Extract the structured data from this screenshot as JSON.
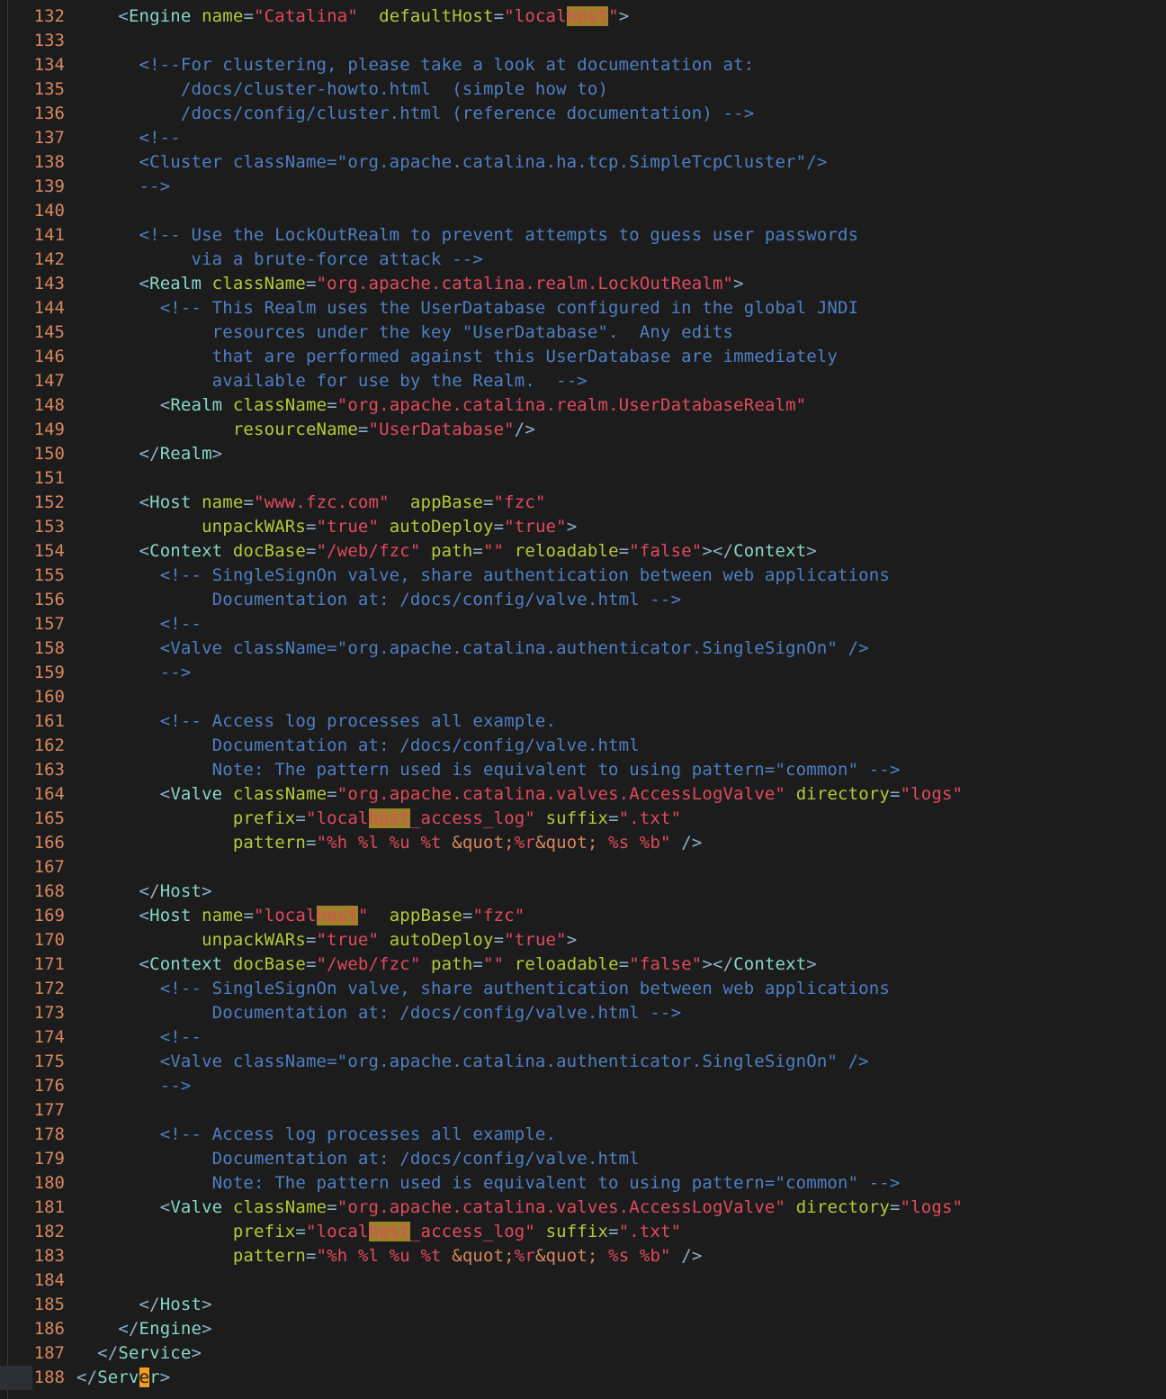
{
  "editor": {
    "first_line": 132,
    "current_line": 188,
    "lines": [
      {
        "n": "132",
        "t": [
          [
            "p",
            "    "
          ],
          [
            "p",
            "<"
          ],
          [
            "g",
            "Engine"
          ],
          [
            "p",
            " "
          ],
          [
            "a",
            "name"
          ],
          [
            "p",
            "="
          ],
          [
            "s",
            "\"Catalina\""
          ],
          [
            "p",
            "  "
          ],
          [
            "a",
            "defaultHost"
          ],
          [
            "p",
            "="
          ],
          [
            "s",
            "\"local"
          ],
          [
            "h",
            "host"
          ],
          [
            "s",
            "\""
          ],
          [
            "p",
            ">"
          ]
        ]
      },
      {
        "n": "133",
        "t": []
      },
      {
        "n": "134",
        "t": [
          [
            "c",
            "      <!--For clustering, please take a look at documentation at:"
          ]
        ]
      },
      {
        "n": "135",
        "t": [
          [
            "c",
            "          /docs/cluster-howto.html  (simple how to)"
          ]
        ]
      },
      {
        "n": "136",
        "t": [
          [
            "c",
            "          /docs/config/cluster.html (reference documentation) -->"
          ]
        ]
      },
      {
        "n": "137",
        "t": [
          [
            "c",
            "      <!--"
          ]
        ]
      },
      {
        "n": "138",
        "t": [
          [
            "c",
            "      <Cluster className=\"org.apache.catalina.ha.tcp.SimpleTcpCluster\"/>"
          ]
        ]
      },
      {
        "n": "139",
        "t": [
          [
            "c",
            "      -->"
          ]
        ]
      },
      {
        "n": "140",
        "t": []
      },
      {
        "n": "141",
        "t": [
          [
            "c",
            "      <!-- Use the LockOutRealm to prevent attempts to guess user passwords"
          ]
        ]
      },
      {
        "n": "142",
        "t": [
          [
            "c",
            "           via a brute-force attack -->"
          ]
        ]
      },
      {
        "n": "143",
        "t": [
          [
            "p",
            "      <"
          ],
          [
            "g",
            "Realm"
          ],
          [
            "p",
            " "
          ],
          [
            "a",
            "className"
          ],
          [
            "p",
            "="
          ],
          [
            "s",
            "\"org.apache.catalina.realm.LockOutRealm\""
          ],
          [
            "p",
            ">"
          ]
        ]
      },
      {
        "n": "144",
        "t": [
          [
            "c",
            "        <!-- This Realm uses the UserDatabase configured in the global JNDI"
          ]
        ]
      },
      {
        "n": "145",
        "t": [
          [
            "c",
            "             resources under the key \"UserDatabase\".  Any edits"
          ]
        ]
      },
      {
        "n": "146",
        "t": [
          [
            "c",
            "             that are performed against this UserDatabase are immediately"
          ]
        ]
      },
      {
        "n": "147",
        "t": [
          [
            "c",
            "             available for use by the Realm.  -->"
          ]
        ]
      },
      {
        "n": "148",
        "t": [
          [
            "p",
            "        <"
          ],
          [
            "g",
            "Realm"
          ],
          [
            "p",
            " "
          ],
          [
            "a",
            "className"
          ],
          [
            "p",
            "="
          ],
          [
            "s",
            "\"org.apache.catalina.realm.UserDatabaseRealm\""
          ]
        ]
      },
      {
        "n": "149",
        "t": [
          [
            "p",
            "               "
          ],
          [
            "a",
            "resourceName"
          ],
          [
            "p",
            "="
          ],
          [
            "s",
            "\"UserDatabase\""
          ],
          [
            "p",
            "/>"
          ]
        ]
      },
      {
        "n": "150",
        "t": [
          [
            "p",
            "      </"
          ],
          [
            "g",
            "Realm"
          ],
          [
            "p",
            ">"
          ]
        ]
      },
      {
        "n": "151",
        "t": []
      },
      {
        "n": "152",
        "t": [
          [
            "p",
            "      <"
          ],
          [
            "g",
            "Host"
          ],
          [
            "p",
            " "
          ],
          [
            "a",
            "name"
          ],
          [
            "p",
            "="
          ],
          [
            "s",
            "\"www.fzc.com\""
          ],
          [
            "p",
            "  "
          ],
          [
            "a",
            "appBase"
          ],
          [
            "p",
            "="
          ],
          [
            "s",
            "\"fzc\""
          ]
        ]
      },
      {
        "n": "153",
        "t": [
          [
            "p",
            "            "
          ],
          [
            "a",
            "unpackWARs"
          ],
          [
            "p",
            "="
          ],
          [
            "s",
            "\"true\""
          ],
          [
            "p",
            " "
          ],
          [
            "a",
            "autoDeploy"
          ],
          [
            "p",
            "="
          ],
          [
            "s",
            "\"true\""
          ],
          [
            "p",
            ">"
          ]
        ]
      },
      {
        "n": "154",
        "t": [
          [
            "p",
            "      <"
          ],
          [
            "g",
            "Context"
          ],
          [
            "p",
            " "
          ],
          [
            "a",
            "docBase"
          ],
          [
            "p",
            "="
          ],
          [
            "s",
            "\"/web/fzc\""
          ],
          [
            "p",
            " "
          ],
          [
            "a",
            "path"
          ],
          [
            "p",
            "="
          ],
          [
            "s",
            "\"\""
          ],
          [
            "p",
            " "
          ],
          [
            "a",
            "reloadable"
          ],
          [
            "p",
            "="
          ],
          [
            "s",
            "\"false\""
          ],
          [
            "p",
            "></"
          ],
          [
            "g",
            "Context"
          ],
          [
            "p",
            ">"
          ]
        ]
      },
      {
        "n": "155",
        "t": [
          [
            "c",
            "        <!-- SingleSignOn valve, share authentication between web applications"
          ]
        ]
      },
      {
        "n": "156",
        "t": [
          [
            "c",
            "             Documentation at: /docs/config/valve.html -->"
          ]
        ]
      },
      {
        "n": "157",
        "t": [
          [
            "c",
            "        <!--"
          ]
        ]
      },
      {
        "n": "158",
        "t": [
          [
            "c",
            "        <Valve className=\"org.apache.catalina.authenticator.SingleSignOn\" />"
          ]
        ]
      },
      {
        "n": "159",
        "t": [
          [
            "c",
            "        -->"
          ]
        ]
      },
      {
        "n": "160",
        "t": []
      },
      {
        "n": "161",
        "t": [
          [
            "c",
            "        <!-- Access log processes all example."
          ]
        ]
      },
      {
        "n": "162",
        "t": [
          [
            "c",
            "             Documentation at: /docs/config/valve.html"
          ]
        ]
      },
      {
        "n": "163",
        "t": [
          [
            "c",
            "             Note: The pattern used is equivalent to using pattern=\"common\" -->"
          ]
        ]
      },
      {
        "n": "164",
        "t": [
          [
            "p",
            "        <"
          ],
          [
            "g",
            "Valve"
          ],
          [
            "p",
            " "
          ],
          [
            "a",
            "className"
          ],
          [
            "p",
            "="
          ],
          [
            "s",
            "\"org.apache.catalina.valves.AccessLogValve\""
          ],
          [
            "p",
            " "
          ],
          [
            "a",
            "directory"
          ],
          [
            "p",
            "="
          ],
          [
            "s",
            "\"logs\""
          ]
        ]
      },
      {
        "n": "165",
        "t": [
          [
            "p",
            "               "
          ],
          [
            "a",
            "prefix"
          ],
          [
            "p",
            "="
          ],
          [
            "s",
            "\"local"
          ],
          [
            "h",
            "host"
          ],
          [
            "s",
            "_access_log\""
          ],
          [
            "p",
            " "
          ],
          [
            "a",
            "suffix"
          ],
          [
            "p",
            "="
          ],
          [
            "s",
            "\".txt\""
          ]
        ]
      },
      {
        "n": "166",
        "t": [
          [
            "p",
            "               "
          ],
          [
            "a",
            "pattern"
          ],
          [
            "p",
            "="
          ],
          [
            "s",
            "\"%h %l %u %t "
          ],
          [
            "e",
            "&quot;"
          ],
          [
            "s",
            "%r"
          ],
          [
            "e",
            "&quot;"
          ],
          [
            "s",
            " %s %b\""
          ],
          [
            "p",
            " />"
          ]
        ]
      },
      {
        "n": "167",
        "t": []
      },
      {
        "n": "168",
        "t": [
          [
            "p",
            "      </"
          ],
          [
            "g",
            "Host"
          ],
          [
            "p",
            ">"
          ]
        ]
      },
      {
        "n": "169",
        "t": [
          [
            "p",
            "      <"
          ],
          [
            "g",
            "Host"
          ],
          [
            "p",
            " "
          ],
          [
            "a",
            "name"
          ],
          [
            "p",
            "="
          ],
          [
            "s",
            "\"local"
          ],
          [
            "h",
            "host"
          ],
          [
            "s",
            "\""
          ],
          [
            "p",
            "  "
          ],
          [
            "a",
            "appBase"
          ],
          [
            "p",
            "="
          ],
          [
            "s",
            "\"fzc\""
          ]
        ]
      },
      {
        "n": "170",
        "t": [
          [
            "p",
            "            "
          ],
          [
            "a",
            "unpackWARs"
          ],
          [
            "p",
            "="
          ],
          [
            "s",
            "\"true\""
          ],
          [
            "p",
            " "
          ],
          [
            "a",
            "autoDeploy"
          ],
          [
            "p",
            "="
          ],
          [
            "s",
            "\"true\""
          ],
          [
            "p",
            ">"
          ]
        ]
      },
      {
        "n": "171",
        "t": [
          [
            "p",
            "      <"
          ],
          [
            "g",
            "Context"
          ],
          [
            "p",
            " "
          ],
          [
            "a",
            "docBase"
          ],
          [
            "p",
            "="
          ],
          [
            "s",
            "\"/web/fzc\""
          ],
          [
            "p",
            " "
          ],
          [
            "a",
            "path"
          ],
          [
            "p",
            "="
          ],
          [
            "s",
            "\"\""
          ],
          [
            "p",
            " "
          ],
          [
            "a",
            "reloadable"
          ],
          [
            "p",
            "="
          ],
          [
            "s",
            "\"false\""
          ],
          [
            "p",
            "></"
          ],
          [
            "g",
            "Context"
          ],
          [
            "p",
            ">"
          ]
        ]
      },
      {
        "n": "172",
        "t": [
          [
            "c",
            "        <!-- SingleSignOn valve, share authentication between web applications"
          ]
        ]
      },
      {
        "n": "173",
        "t": [
          [
            "c",
            "             Documentation at: /docs/config/valve.html -->"
          ]
        ]
      },
      {
        "n": "174",
        "t": [
          [
            "c",
            "        <!--"
          ]
        ]
      },
      {
        "n": "175",
        "t": [
          [
            "c",
            "        <Valve className=\"org.apache.catalina.authenticator.SingleSignOn\" />"
          ]
        ]
      },
      {
        "n": "176",
        "t": [
          [
            "c",
            "        -->"
          ]
        ]
      },
      {
        "n": "177",
        "t": []
      },
      {
        "n": "178",
        "t": [
          [
            "c",
            "        <!-- Access log processes all example."
          ]
        ]
      },
      {
        "n": "179",
        "t": [
          [
            "c",
            "             Documentation at: /docs/config/valve.html"
          ]
        ]
      },
      {
        "n": "180",
        "t": [
          [
            "c",
            "             Note: The pattern used is equivalent to using pattern=\"common\" -->"
          ]
        ]
      },
      {
        "n": "181",
        "t": [
          [
            "p",
            "        <"
          ],
          [
            "g",
            "Valve"
          ],
          [
            "p",
            " "
          ],
          [
            "a",
            "className"
          ],
          [
            "p",
            "="
          ],
          [
            "s",
            "\"org.apache.catalina.valves.AccessLogValve\""
          ],
          [
            "p",
            " "
          ],
          [
            "a",
            "directory"
          ],
          [
            "p",
            "="
          ],
          [
            "s",
            "\"logs\""
          ]
        ]
      },
      {
        "n": "182",
        "t": [
          [
            "p",
            "               "
          ],
          [
            "a",
            "prefix"
          ],
          [
            "p",
            "="
          ],
          [
            "s",
            "\"local"
          ],
          [
            "h",
            "host"
          ],
          [
            "s",
            "_access_log\""
          ],
          [
            "p",
            " "
          ],
          [
            "a",
            "suffix"
          ],
          [
            "p",
            "="
          ],
          [
            "s",
            "\".txt\""
          ]
        ]
      },
      {
        "n": "183",
        "t": [
          [
            "p",
            "               "
          ],
          [
            "a",
            "pattern"
          ],
          [
            "p",
            "="
          ],
          [
            "s",
            "\"%h %l %u %t "
          ],
          [
            "e",
            "&quot;"
          ],
          [
            "s",
            "%r"
          ],
          [
            "e",
            "&quot;"
          ],
          [
            "s",
            " %s %b\""
          ],
          [
            "p",
            " />"
          ]
        ]
      },
      {
        "n": "184",
        "t": []
      },
      {
        "n": "185",
        "t": [
          [
            "p",
            "      </"
          ],
          [
            "g",
            "Host"
          ],
          [
            "p",
            ">"
          ]
        ]
      },
      {
        "n": "186",
        "t": [
          [
            "p",
            "    </"
          ],
          [
            "g",
            "Engine"
          ],
          [
            "p",
            ">"
          ]
        ]
      },
      {
        "n": "187",
        "t": [
          [
            "p",
            "  </"
          ],
          [
            "g",
            "Service"
          ],
          [
            "p",
            ">"
          ]
        ]
      },
      {
        "n": "188",
        "t": [
          [
            "p",
            "</"
          ],
          [
            "g",
            "Serv"
          ],
          [
            "k",
            "e"
          ],
          [
            "g",
            "r"
          ],
          [
            "p",
            ">"
          ]
        ]
      }
    ]
  },
  "colors": {
    "background": "#1c1c1c",
    "line_number": "#d7875f",
    "tag": "#87d7c6",
    "attribute": "#b5c93a",
    "string": "#e04a5f",
    "comment": "#4f7fc2",
    "search_highlight": "#a0802a",
    "cursor": "#f0a020"
  }
}
